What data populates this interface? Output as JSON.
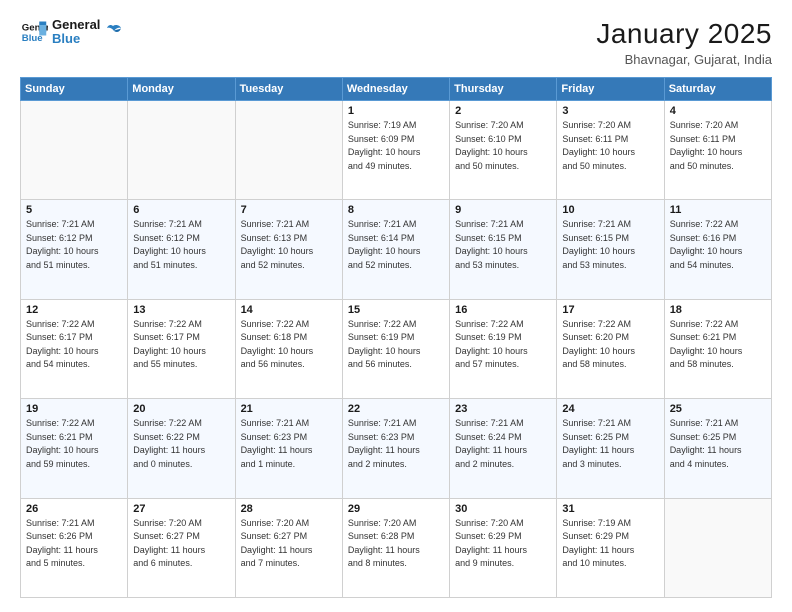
{
  "logo": {
    "line1": "General",
    "line2": "Blue"
  },
  "header": {
    "title": "January 2025",
    "subtitle": "Bhavnagar, Gujarat, India"
  },
  "weekdays": [
    "Sunday",
    "Monday",
    "Tuesday",
    "Wednesday",
    "Thursday",
    "Friday",
    "Saturday"
  ],
  "weeks": [
    [
      {
        "day": "",
        "info": ""
      },
      {
        "day": "",
        "info": ""
      },
      {
        "day": "",
        "info": ""
      },
      {
        "day": "1",
        "info": "Sunrise: 7:19 AM\nSunset: 6:09 PM\nDaylight: 10 hours\nand 49 minutes."
      },
      {
        "day": "2",
        "info": "Sunrise: 7:20 AM\nSunset: 6:10 PM\nDaylight: 10 hours\nand 50 minutes."
      },
      {
        "day": "3",
        "info": "Sunrise: 7:20 AM\nSunset: 6:11 PM\nDaylight: 10 hours\nand 50 minutes."
      },
      {
        "day": "4",
        "info": "Sunrise: 7:20 AM\nSunset: 6:11 PM\nDaylight: 10 hours\nand 50 minutes."
      }
    ],
    [
      {
        "day": "5",
        "info": "Sunrise: 7:21 AM\nSunset: 6:12 PM\nDaylight: 10 hours\nand 51 minutes."
      },
      {
        "day": "6",
        "info": "Sunrise: 7:21 AM\nSunset: 6:12 PM\nDaylight: 10 hours\nand 51 minutes."
      },
      {
        "day": "7",
        "info": "Sunrise: 7:21 AM\nSunset: 6:13 PM\nDaylight: 10 hours\nand 52 minutes."
      },
      {
        "day": "8",
        "info": "Sunrise: 7:21 AM\nSunset: 6:14 PM\nDaylight: 10 hours\nand 52 minutes."
      },
      {
        "day": "9",
        "info": "Sunrise: 7:21 AM\nSunset: 6:15 PM\nDaylight: 10 hours\nand 53 minutes."
      },
      {
        "day": "10",
        "info": "Sunrise: 7:21 AM\nSunset: 6:15 PM\nDaylight: 10 hours\nand 53 minutes."
      },
      {
        "day": "11",
        "info": "Sunrise: 7:22 AM\nSunset: 6:16 PM\nDaylight: 10 hours\nand 54 minutes."
      }
    ],
    [
      {
        "day": "12",
        "info": "Sunrise: 7:22 AM\nSunset: 6:17 PM\nDaylight: 10 hours\nand 54 minutes."
      },
      {
        "day": "13",
        "info": "Sunrise: 7:22 AM\nSunset: 6:17 PM\nDaylight: 10 hours\nand 55 minutes."
      },
      {
        "day": "14",
        "info": "Sunrise: 7:22 AM\nSunset: 6:18 PM\nDaylight: 10 hours\nand 56 minutes."
      },
      {
        "day": "15",
        "info": "Sunrise: 7:22 AM\nSunset: 6:19 PM\nDaylight: 10 hours\nand 56 minutes."
      },
      {
        "day": "16",
        "info": "Sunrise: 7:22 AM\nSunset: 6:19 PM\nDaylight: 10 hours\nand 57 minutes."
      },
      {
        "day": "17",
        "info": "Sunrise: 7:22 AM\nSunset: 6:20 PM\nDaylight: 10 hours\nand 58 minutes."
      },
      {
        "day": "18",
        "info": "Sunrise: 7:22 AM\nSunset: 6:21 PM\nDaylight: 10 hours\nand 58 minutes."
      }
    ],
    [
      {
        "day": "19",
        "info": "Sunrise: 7:22 AM\nSunset: 6:21 PM\nDaylight: 10 hours\nand 59 minutes."
      },
      {
        "day": "20",
        "info": "Sunrise: 7:22 AM\nSunset: 6:22 PM\nDaylight: 11 hours\nand 0 minutes."
      },
      {
        "day": "21",
        "info": "Sunrise: 7:21 AM\nSunset: 6:23 PM\nDaylight: 11 hours\nand 1 minute."
      },
      {
        "day": "22",
        "info": "Sunrise: 7:21 AM\nSunset: 6:23 PM\nDaylight: 11 hours\nand 2 minutes."
      },
      {
        "day": "23",
        "info": "Sunrise: 7:21 AM\nSunset: 6:24 PM\nDaylight: 11 hours\nand 2 minutes."
      },
      {
        "day": "24",
        "info": "Sunrise: 7:21 AM\nSunset: 6:25 PM\nDaylight: 11 hours\nand 3 minutes."
      },
      {
        "day": "25",
        "info": "Sunrise: 7:21 AM\nSunset: 6:25 PM\nDaylight: 11 hours\nand 4 minutes."
      }
    ],
    [
      {
        "day": "26",
        "info": "Sunrise: 7:21 AM\nSunset: 6:26 PM\nDaylight: 11 hours\nand 5 minutes."
      },
      {
        "day": "27",
        "info": "Sunrise: 7:20 AM\nSunset: 6:27 PM\nDaylight: 11 hours\nand 6 minutes."
      },
      {
        "day": "28",
        "info": "Sunrise: 7:20 AM\nSunset: 6:27 PM\nDaylight: 11 hours\nand 7 minutes."
      },
      {
        "day": "29",
        "info": "Sunrise: 7:20 AM\nSunset: 6:28 PM\nDaylight: 11 hours\nand 8 minutes."
      },
      {
        "day": "30",
        "info": "Sunrise: 7:20 AM\nSunset: 6:29 PM\nDaylight: 11 hours\nand 9 minutes."
      },
      {
        "day": "31",
        "info": "Sunrise: 7:19 AM\nSunset: 6:29 PM\nDaylight: 11 hours\nand 10 minutes."
      },
      {
        "day": "",
        "info": ""
      }
    ]
  ]
}
